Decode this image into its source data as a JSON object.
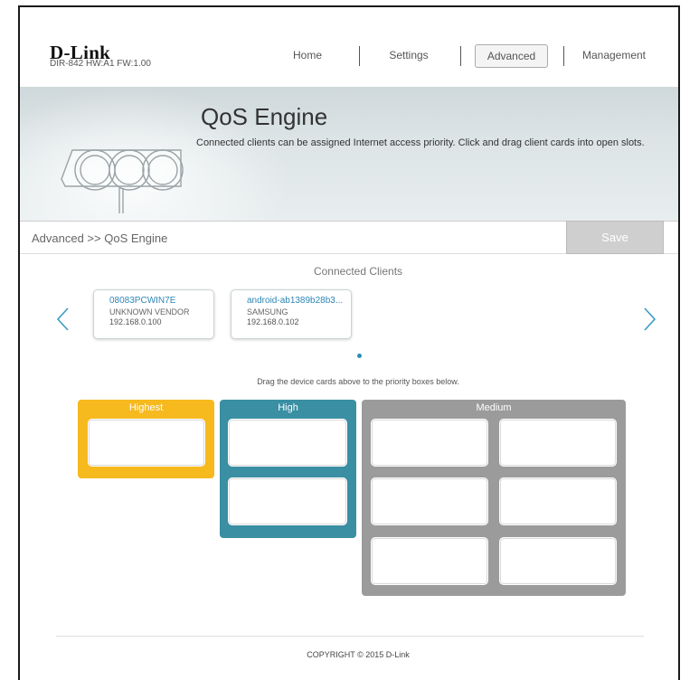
{
  "header": {
    "brand": "D-Link",
    "device_info": "DIR-842   HW:A1   FW:1.00"
  },
  "nav": {
    "items": [
      {
        "label": "Home"
      },
      {
        "label": "Settings"
      },
      {
        "label": "Advanced",
        "active": true
      },
      {
        "label": "Management"
      }
    ]
  },
  "banner": {
    "title": "QoS Engine",
    "description": "Connected clients can be assigned Internet access priority. Click and drag client cards into open slots."
  },
  "breadcrumb": {
    "text": "Advanced >> QoS Engine",
    "save_label": "Save"
  },
  "clients": {
    "title": "Connected Clients",
    "cards": [
      {
        "name": "08083PCWIN7E",
        "vendor": "UNKNOWN VENDOR",
        "ip": "192.168.0.100"
      },
      {
        "name": "android-ab1389b28b3...",
        "vendor": "SAMSUNG",
        "ip": "192.168.0.102"
      }
    ],
    "hint": "Drag the device cards above to the priority boxes below."
  },
  "priorities": {
    "highest": {
      "label": "Highest",
      "color": "#f6b91e"
    },
    "high": {
      "label": "High",
      "color": "#3a8fa3"
    },
    "medium": {
      "label": "Medium",
      "color": "#9b9b9b"
    }
  },
  "icons": {
    "prev": "chevron-left-icon",
    "next": "chevron-right-icon"
  },
  "footer": {
    "copyright": "COPYRIGHT © 2015 D-Link"
  }
}
